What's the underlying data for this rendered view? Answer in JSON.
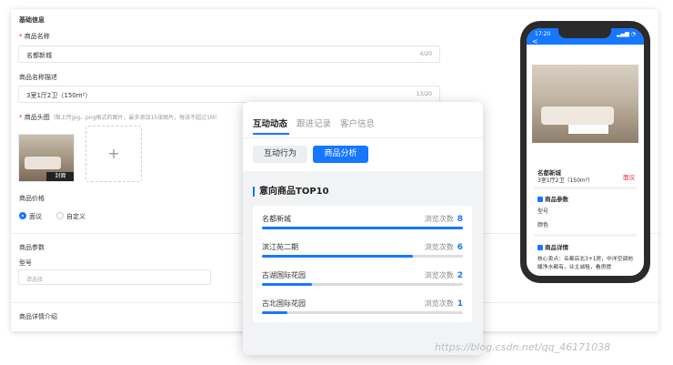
{
  "form": {
    "section_basic": "基础信息",
    "name_label": "商品名称",
    "name_value": "名都新城",
    "name_count": "4/20",
    "desc_label": "商品名称描述",
    "desc_value": "3室1厅2卫（150m²）",
    "desc_count": "13/20",
    "image_label": "商品头图",
    "image_hint": "（限上传jpg、png格式的图片，最多添加15张图片，每张不超过1M）",
    "cover_label": "封面",
    "upload_plus": "+",
    "price_label": "商品价格",
    "price_options": [
      {
        "label": "面议",
        "selected": true
      },
      {
        "label": "自定义",
        "selected": false
      }
    ],
    "params_label": "商品参数",
    "model_label": "型号",
    "model_placeholder": "请选择",
    "detail_label": "商品详情介绍"
  },
  "phone": {
    "time": "17:20",
    "status": "▂▄▆ ◔",
    "back": "<",
    "product_name": "名都新城",
    "product_sub": "3室1厅2卫（150m²）",
    "price_tag": "面议",
    "params_title": "商品参数",
    "param_model": "型号",
    "param_color": "颜色",
    "detail_title": "商品详情",
    "detail_text": "核心卖点：名都店北3+1房，中洋空调地暖净水都有，业主诚租，看房提"
  },
  "card": {
    "tabs": [
      "互动动态",
      "跟进记录",
      "客户信息"
    ],
    "active_tab": 0,
    "segments": [
      "互动行为",
      "商品分析"
    ],
    "active_segment": 1,
    "rank_title": "意向商品TOP10",
    "views_label": "浏览次数",
    "items": [
      {
        "name": "名都新城",
        "views": 8
      },
      {
        "name": "滨江苑二期",
        "views": 6
      },
      {
        "name": "古湖国际花园",
        "views": 2
      },
      {
        "name": "古北国际花园",
        "views": 1
      }
    ]
  },
  "watermark": "https://blog.csdn.net/qq_46171038",
  "colors": {
    "accent": "#1677ff",
    "required": "#f5222d"
  }
}
